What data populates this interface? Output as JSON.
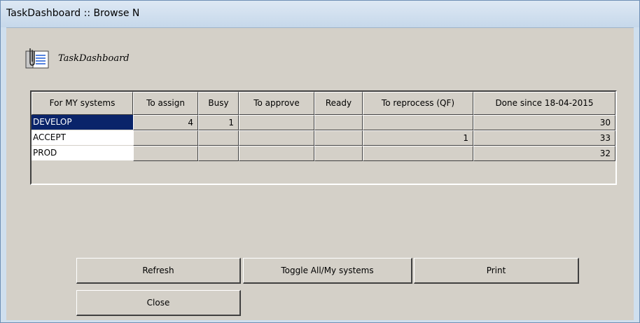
{
  "window": {
    "title": "TaskDashboard :: Browse N"
  },
  "app": {
    "name": "TaskDashboard",
    "icon": "clipboard-document-icon"
  },
  "table": {
    "columns": [
      "For MY systems",
      "To assign",
      "Busy",
      "To approve",
      "Ready",
      "To reprocess (QF)",
      "Done since 18-04-2015"
    ],
    "rows": [
      {
        "system": "DEVELOP",
        "selected": true,
        "values": [
          "4",
          "1",
          "",
          "",
          "",
          "30"
        ]
      },
      {
        "system": "ACCEPT",
        "selected": false,
        "values": [
          "",
          "",
          "",
          "",
          "1",
          "33"
        ]
      },
      {
        "system": "PROD",
        "selected": false,
        "values": [
          "",
          "",
          "",
          "",
          "",
          "32"
        ]
      }
    ]
  },
  "buttons": {
    "refresh": "Refresh",
    "toggle": "Toggle All/My systems",
    "print": "Print",
    "close": "Close"
  },
  "colors": {
    "selection": "#0a246a",
    "window_frame": "#cfdfee",
    "face": "#d4d0c8"
  }
}
